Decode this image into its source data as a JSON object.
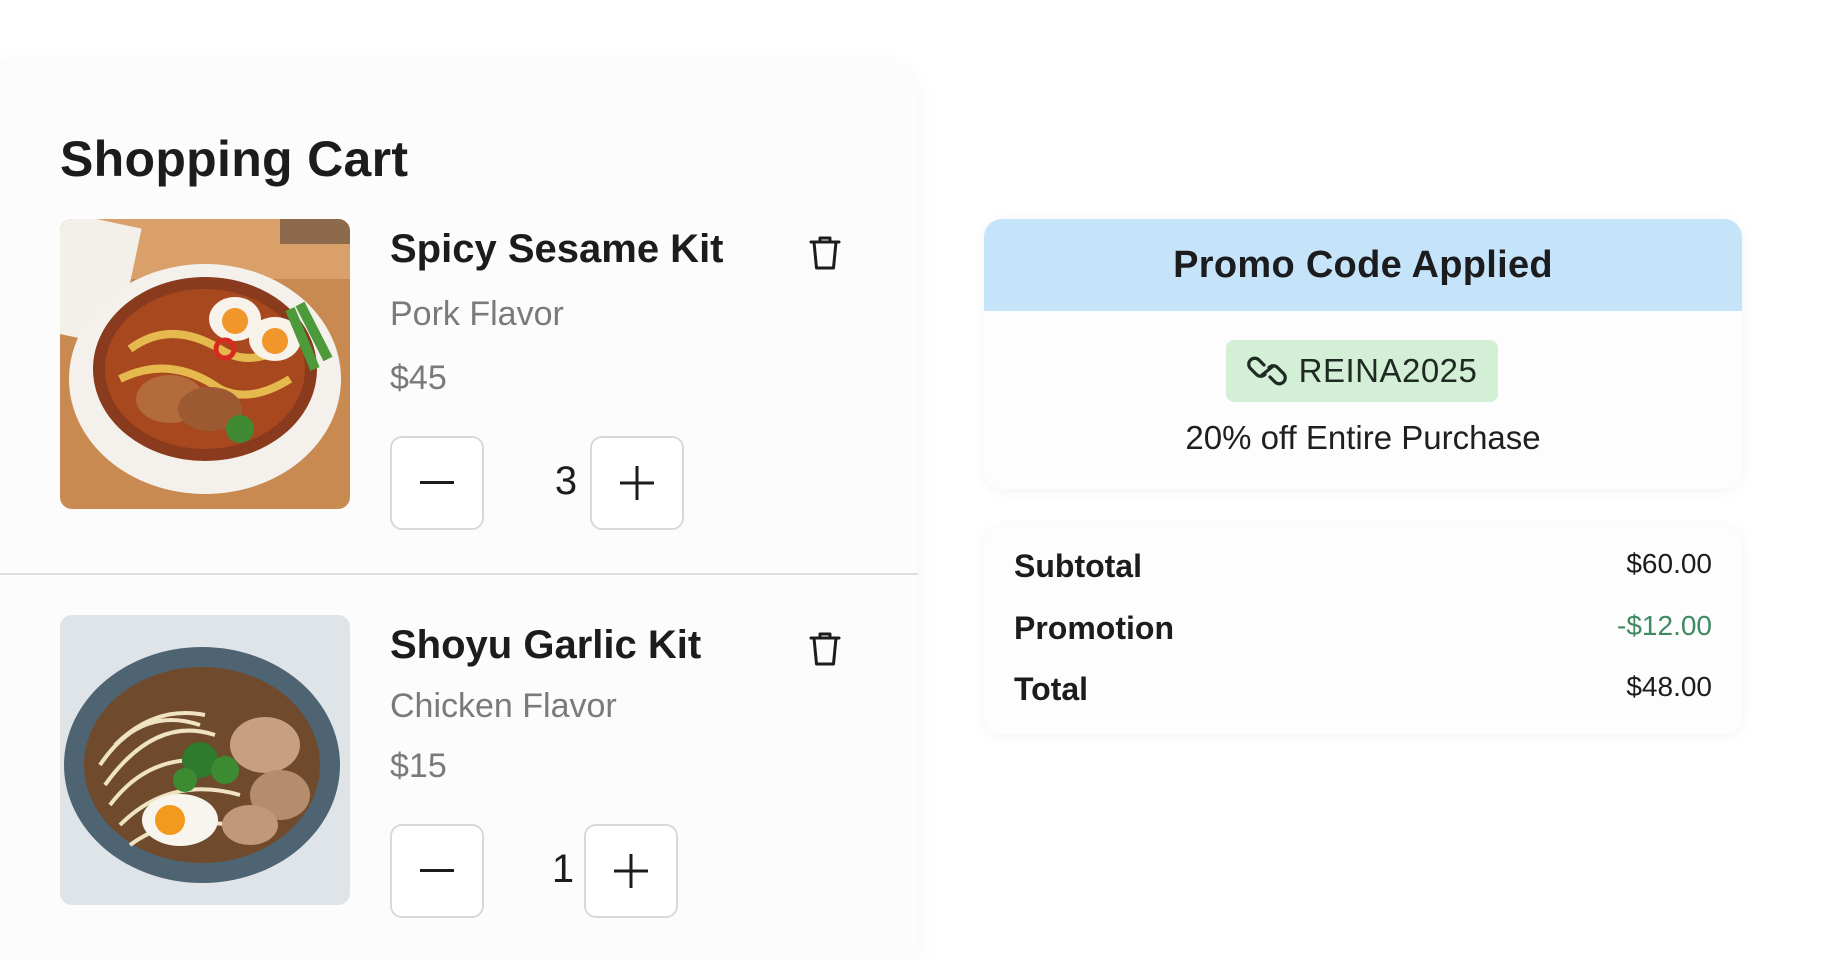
{
  "cart": {
    "title": "Shopping Cart",
    "items": [
      {
        "name": "Spicy Sesame Kit",
        "flavor": "Pork Flavor",
        "price": "$45",
        "quantity": "3",
        "image": "spicy-ramen-bowl-photo"
      },
      {
        "name": "Shoyu Garlic Kit",
        "flavor": "Chicken Flavor",
        "price": "$15",
        "quantity": "1",
        "image": "shoyu-ramen-bowl-photo"
      }
    ],
    "icons": {
      "delete": "trash-icon",
      "decrease": "minus-icon",
      "increase": "plus-icon"
    }
  },
  "promo": {
    "header": "Promo Code Applied",
    "code": "REINA2025",
    "code_icon": "link-icon",
    "description": "20% off Entire Purchase"
  },
  "summary": {
    "subtotal_label": "Subtotal",
    "subtotal_value": "$60.00",
    "promotion_label": "Promotion",
    "promotion_value": "-$12.00",
    "total_label": "Total",
    "total_value": "$48.00"
  },
  "colors": {
    "promo_header_bg": "#c5e4fa",
    "promo_chip_bg": "#d3f0d6",
    "discount_text": "#3f8a62",
    "muted_text": "#7a7a7e"
  }
}
